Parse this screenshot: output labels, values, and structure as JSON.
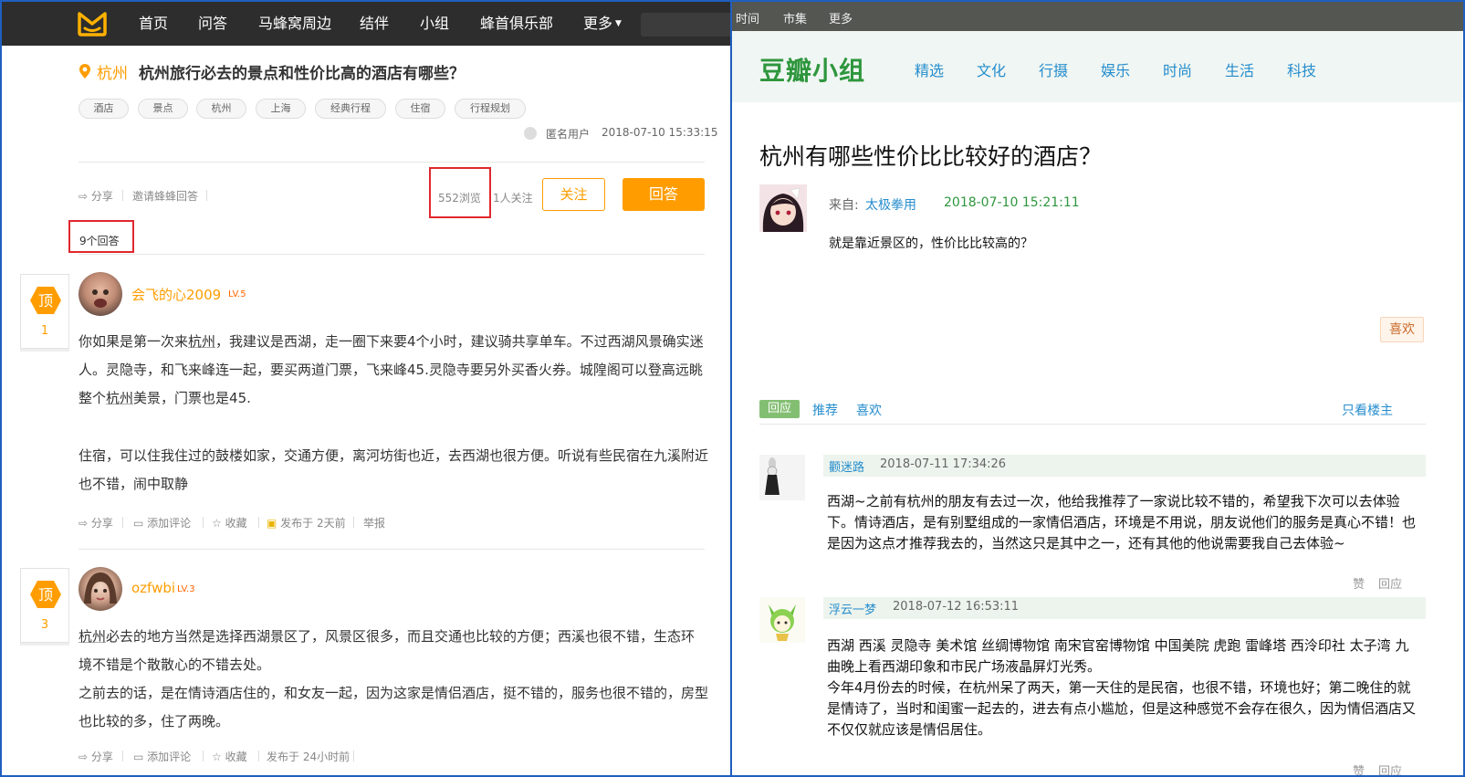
{
  "mafengwo": {
    "nav": [
      "首页",
      "问答",
      "马蜂窝周边",
      "结伴",
      "小组",
      "蜂首俱乐部",
      "更多"
    ],
    "question": {
      "city": "杭州",
      "title": "杭州旅行必去的景点和性价比高的酒店有哪些？",
      "tags": [
        "酒店",
        "景点",
        "杭州",
        "上海",
        "经典行程",
        "住宿",
        "行程规划"
      ],
      "author": "匿名用户",
      "time": "2018-07-10 15:33:15"
    },
    "actions": {
      "share": "分享",
      "invite": "邀请蜂蜂回答",
      "views": "552浏览",
      "followers": "1人关注",
      "follow_btn": "关注",
      "answer_btn": "回答"
    },
    "answer_count": "9个回答",
    "vote_label": "顶",
    "answers": [
      {
        "votes": "1",
        "user": "会飞的心2009",
        "level": "LV.5",
        "p1_a": "你如果是第一次来",
        "p1_link": "杭州",
        "p1_b": "，我建议是西湖，走一圈下来要4个小时，建议骑共享单车。不过西湖风景确实迷人。灵隐寺，和飞来峰连一起，要买两道门票，飞来峰45.灵隐寺要另外买香火券。城隍阁可以登高远眺整个",
        "p1_link2": "杭州",
        "p1_c": "美景，门票也是45.",
        "p2": "住宿，可以住我住过的鼓楼如家，交通方便，离河坊街也近，去西湖也很方便。听说有些民宿在九溪附近也不错，闹中取静",
        "footer": [
          "分享",
          "添加评论",
          "收藏",
          "发布于 2天前",
          "举报"
        ]
      },
      {
        "votes": "3",
        "user": "ozfwbi",
        "level": "LV.3",
        "p1_link": "杭州",
        "p1_b": "必去的地方当然是选择西湖景区了，风景区很多，而且交通也比较的方便；西溪也很不错，生态环境不错是个散散心的不错去处。",
        "p2": "之前去的话，是在情诗酒店住的，和女友一起，因为这家是情侣酒店，挺不错的，服务也很不错的，房型也比较的多，住了两晚。",
        "footer": [
          "分享",
          "添加评论",
          "收藏",
          "发布于 24小时前"
        ]
      }
    ]
  },
  "douban": {
    "topbar": [
      "时间",
      "市集",
      "更多"
    ],
    "logo": "豆瓣小组",
    "nav": [
      "精选",
      "文化",
      "行摄",
      "娱乐",
      "时尚",
      "生活",
      "科技"
    ],
    "title": "杭州有哪些性价比比较好的酒店？",
    "from_label": "来自:",
    "from_user": "太极拳用",
    "from_time": "2018-07-10 15:21:11",
    "content": "就是靠近景区的，性价比比较高的？",
    "like_btn": "喜欢",
    "tabs": [
      "回应",
      "推荐",
      "喜欢"
    ],
    "only_op": "只看楼主",
    "comments": [
      {
        "user": "颧迷路",
        "time": "2018-07-11 17:34:26",
        "text": "西湖~之前有杭州的朋友有去过一次，他给我推荐了一家说比较不错的，希望我下次可以去体验下。情诗酒店，是有别墅组成的一家情侣酒店，环境是不用说，朋友说他们的服务是真心不错！也是因为这点才推荐我去的，当然这只是其中之一，还有其他的他说需要我自己去体验~",
        "like": "赞",
        "reply": "回应"
      },
      {
        "user": "浮云一梦",
        "time": "2018-07-12 16:53:11",
        "text1": "西湖 西溪 灵隐寺 美术馆 丝绸博物馆 南宋官窑博物馆 中国美院 虎跑 雷峰塔 西泠印社 太子湾 九曲晚上看西湖印象和市民广场液晶屏灯光秀。",
        "text2": "今年4月份去的时候，在杭州呆了两天，第一天住的是民宿，也很不错，环境也好；第二晚住的就是情诗了，当时和闺蜜一起去的，进去有点小尴尬，但是这种感觉不会存在很久，因为情侣酒店又不仅仅就应该是情侣居住。",
        "like": "赞",
        "reply": "回应"
      }
    ]
  },
  "colors": {
    "mfw_orange": "#ff9d00",
    "highlight_red": "#e0282e",
    "douban_green": "#2e963d",
    "douban_link": "#268dcd",
    "panel_border": "#1f5fbf"
  }
}
